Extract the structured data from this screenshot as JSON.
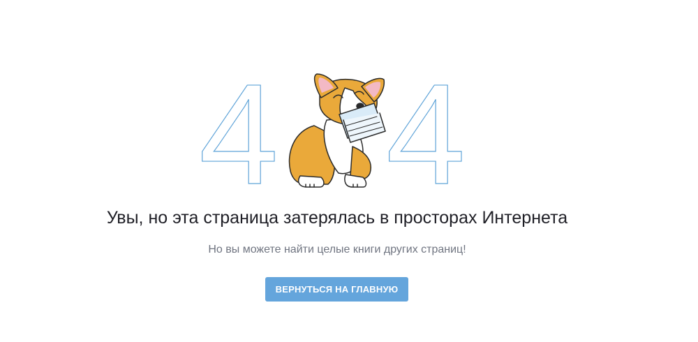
{
  "error": {
    "code_left": "4",
    "code_right": "4",
    "illustration": "corgi-with-book"
  },
  "message": {
    "title": "Увы, но эта страница затерялась в просторах Интернета",
    "subtitle": "Но вы можете найти целые книги других страниц!"
  },
  "actions": {
    "home_button": "ВЕРНУТЬСЯ НА ГЛАВНУЮ"
  },
  "colors": {
    "outline_blue": "#5ea3d8",
    "button_blue": "#64a5dc",
    "corgi_orange": "#eaa93a",
    "ear_pink": "#f3b9c5",
    "book_blue": "#d9ebf8"
  }
}
